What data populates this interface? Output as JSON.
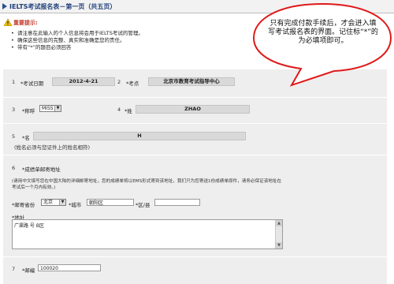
{
  "header": {
    "title": "IELTS考试报名表－第一页（共五页）"
  },
  "notice": {
    "title": "重要提示:",
    "items": [
      "请注意在此输入的个人信息将会用于IELTS考试的管理。",
      "确保这些信息的完整、真实和准确是您的责任。",
      "带有“*”的题目必须回答"
    ]
  },
  "callout": {
    "text": "只有完成付款手续后，才会进入填写考试报名表的界面。记住标“*”的为必填项即可。"
  },
  "fields": {
    "exam_date": {
      "num": "1",
      "label": "*考试日期",
      "value": "2012-4-21"
    },
    "venue": {
      "num": "2",
      "label": "*考点",
      "value": "北京市教育考试指导中心"
    },
    "title": {
      "num": "3",
      "label": "*称呼",
      "value": "MISS"
    },
    "surname": {
      "num": "4",
      "label": "*姓",
      "value": "ZHAO"
    },
    "given_name": {
      "num": "5",
      "label": "*名",
      "value": "H",
      "note": "(姓名必须与您证件上的姓名相符)"
    },
    "address": {
      "num": "6",
      "label": "*成绩单邮寄地址",
      "note_line1": "(请用中文填写您在中国大陆的详细邮寄地址，您的成绩单将以EMS形式寄到该地址，我们只为您寄送1份成绩单原件，请务必保证该地址在",
      "note_line2": "考试后一个月内有效。)",
      "province_label": "*邮寄省份",
      "province_value": "北京",
      "city_label": "*城市",
      "city_value": "朝阳区",
      "district_label": "*区/县",
      "district_value": "",
      "address_label": "*地址",
      "address_value": "广渠路    号         B区"
    },
    "postcode": {
      "num": "7",
      "label": "*邮编",
      "value": "100020"
    }
  }
}
